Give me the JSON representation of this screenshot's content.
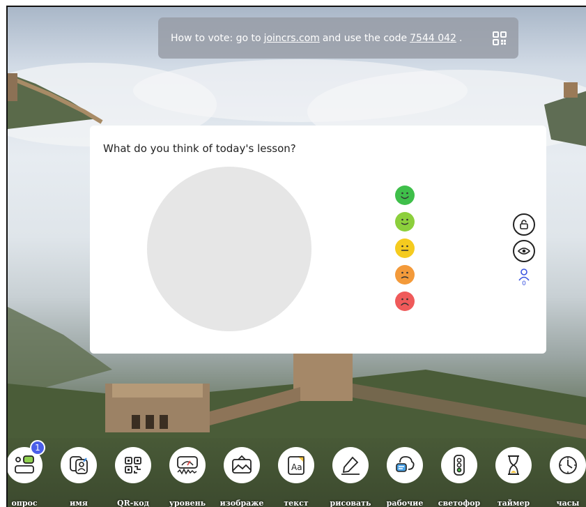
{
  "banner": {
    "prefix": "How to vote: go to",
    "link": "joincrs.com",
    "middle": "and use the code",
    "code": "7544 042",
    "suffix": "."
  },
  "poll": {
    "question": "What do you think of today's lesson?",
    "options": [
      {
        "icon": "very-happy-face-icon",
        "color": "#3fbf4a"
      },
      {
        "icon": "happy-face-icon",
        "color": "#8ccf3c"
      },
      {
        "icon": "neutral-face-icon",
        "color": "#f5cb1f"
      },
      {
        "icon": "sad-face-icon",
        "color": "#f39a3a"
      },
      {
        "icon": "very-sad-face-icon",
        "color": "#ef5a5a"
      }
    ],
    "participants": "0"
  },
  "toolbar": {
    "tools": [
      {
        "label": "опрос",
        "icon": "poll-icon",
        "badge": "1"
      },
      {
        "label": "имя",
        "icon": "name-picker-icon"
      },
      {
        "label": "QR-код",
        "icon": "qr-code-icon"
      },
      {
        "label": "уровень",
        "icon": "sound-level-icon"
      },
      {
        "label": "изображе",
        "icon": "image-icon"
      },
      {
        "label": "текст",
        "icon": "text-icon"
      },
      {
        "label": "рисовать",
        "icon": "draw-icon"
      },
      {
        "label": "рабочие",
        "icon": "worksheets-icon"
      },
      {
        "label": "светофор",
        "icon": "traffic-light-icon"
      },
      {
        "label": "таймер",
        "icon": "timer-icon"
      },
      {
        "label": "часы",
        "icon": "clock-icon"
      }
    ]
  },
  "colors": {
    "accent": "#4a5ee8",
    "card_bg": "#ffffff",
    "pie_empty": "#e6e6e6"
  }
}
